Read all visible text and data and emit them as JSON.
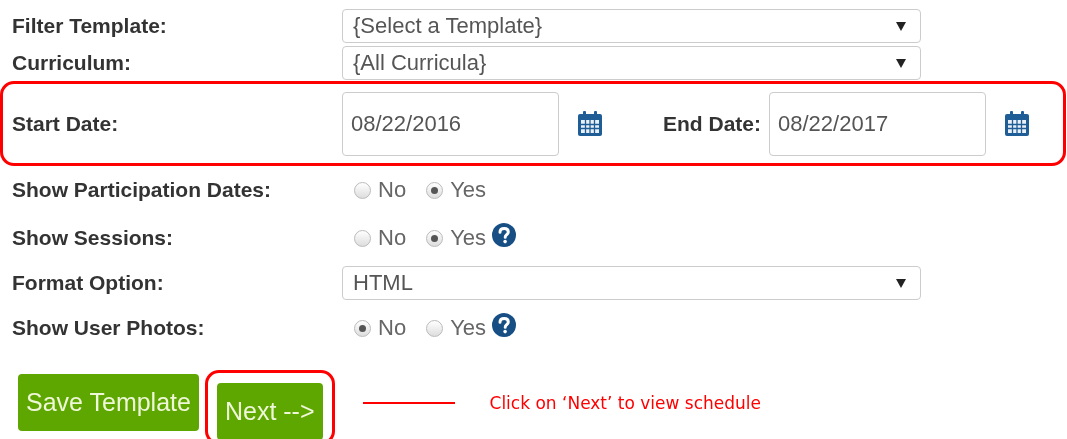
{
  "fields": [
    {
      "kind": "select",
      "label": "Filter Template:",
      "value": "{Select a Template}"
    },
    {
      "kind": "select",
      "label": "Curriculum:",
      "value": "{All Curricula}"
    },
    {
      "kind": "dates",
      "highlighted": true,
      "parts": [
        {
          "label": "Start Date:",
          "value": "08/22/2016"
        },
        {
          "label": "End Date:",
          "value": "08/22/2017"
        }
      ]
    },
    {
      "kind": "radio",
      "label": "Show Participation Dates:",
      "help": false,
      "options": [
        {
          "label": "No",
          "selected": false
        },
        {
          "label": "Yes",
          "selected": true
        }
      ]
    },
    {
      "kind": "radio",
      "label": "Show Sessions:",
      "help": true,
      "options": [
        {
          "label": "No",
          "selected": false
        },
        {
          "label": "Yes",
          "selected": true
        }
      ]
    },
    {
      "kind": "select",
      "label": "Format Option:",
      "value": "HTML"
    },
    {
      "kind": "radio",
      "label": "Show User Photos:",
      "help": true,
      "options": [
        {
          "label": "No",
          "selected": true
        },
        {
          "label": "Yes",
          "selected": false
        }
      ]
    }
  ],
  "buttons": [
    {
      "label": "Save Template",
      "highlighted": false
    },
    {
      "label": "Next -->",
      "highlighted": true
    }
  ],
  "annotation": {
    "text": "Click on ‘Next’ to view schedule"
  }
}
